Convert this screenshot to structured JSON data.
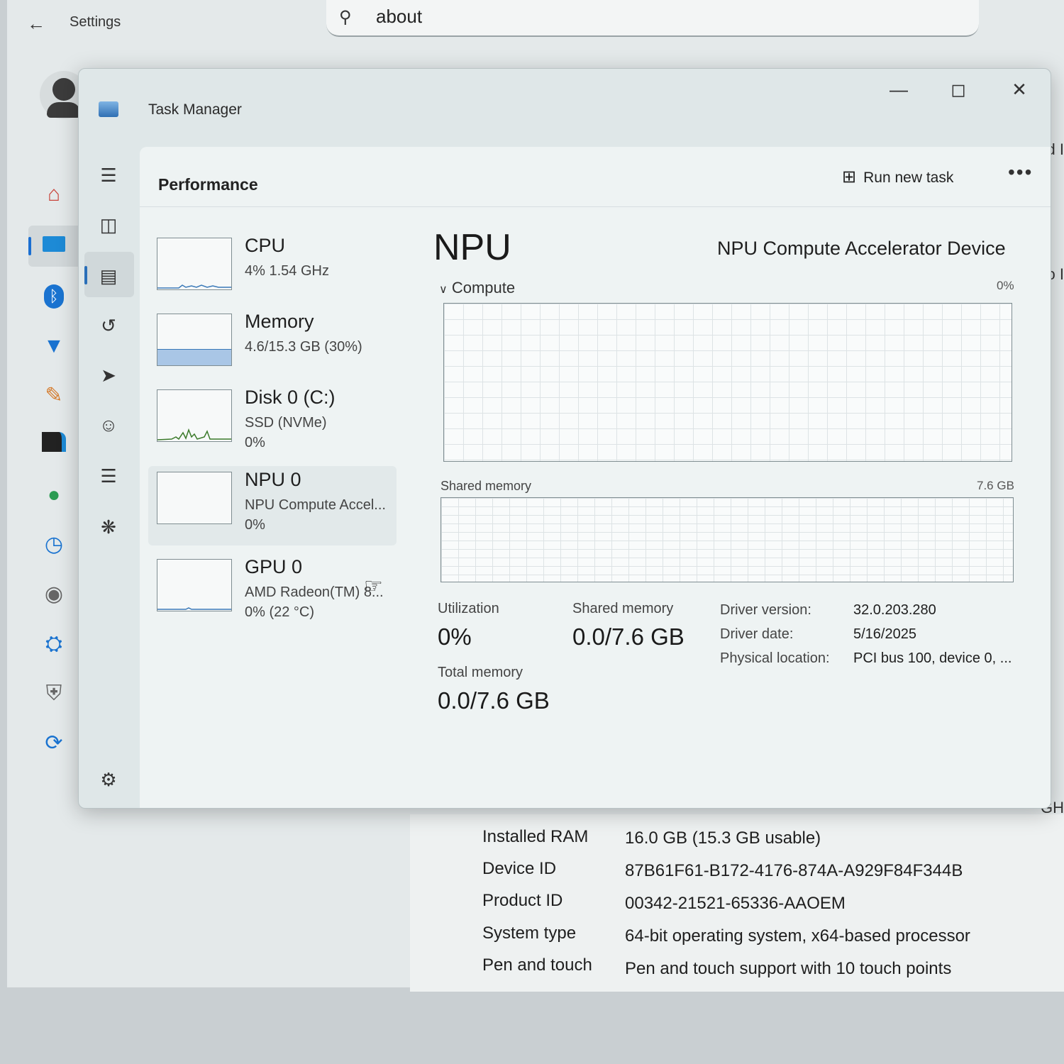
{
  "settings": {
    "title": "Settings",
    "search_value": "about",
    "nav_icons": [
      "home-icon",
      "system-icon",
      "bluetooth-icon",
      "wifi-icon",
      "personalization-icon",
      "apps-icon",
      "accounts-icon",
      "time-language-icon",
      "gaming-icon",
      "accessibility-icon",
      "privacy-security-icon",
      "windows-update-icon"
    ],
    "clipped_text": [
      "d I",
      "o I",
      "GH"
    ],
    "about_specs": [
      {
        "label": "Installed RAM",
        "value": "16.0 GB (15.3 GB usable)"
      },
      {
        "label": "Device ID",
        "value": "87B61F61-B172-4176-874A-A929F84F344B"
      },
      {
        "label": "Product ID",
        "value": "00342-21521-65336-AAOEM"
      },
      {
        "label": "System type",
        "value": "64-bit operating system, x64-based processor"
      },
      {
        "label": "Pen and touch",
        "value": "Pen and touch support with 10 touch points"
      }
    ]
  },
  "task_manager": {
    "title": "Task Manager",
    "page_title": "Performance",
    "run_new_task": "Run new task",
    "more": "•••",
    "rail_icons": [
      "hamburger-menu-icon",
      "processes-icon",
      "performance-icon",
      "app-history-icon",
      "startup-apps-icon",
      "users-icon",
      "details-icon",
      "services-icon",
      "settings-icon"
    ],
    "resources": [
      {
        "name": "CPU",
        "sub1": "4%  1.54 GHz",
        "sub2": ""
      },
      {
        "name": "Memory",
        "sub1": "4.6/15.3 GB (30%)",
        "sub2": "",
        "memory_fraction": 0.3
      },
      {
        "name": "Disk 0 (C:)",
        "sub1": "SSD (NVMe)",
        "sub2": "0%"
      },
      {
        "name": "NPU 0",
        "sub1": "NPU Compute Accel...",
        "sub2": "0%"
      },
      {
        "name": "GPU 0",
        "sub1": "AMD Radeon(TM) 8...",
        "sub2": "0%  (22 °C)"
      }
    ],
    "detail": {
      "heading": "NPU",
      "device_name": "NPU Compute Accelerator Device",
      "compute_label": "Compute",
      "compute_max": "0%",
      "shared_memory_label": "Shared memory",
      "shared_memory_max": "7.6 GB",
      "utilization_label": "Utilization",
      "utilization_value": "0%",
      "shared_mem_stat_label": "Shared memory",
      "shared_mem_stat_value": "0.0/7.6 GB",
      "total_memory_label": "Total memory",
      "total_memory_value": "0.0/7.6 GB",
      "driver": [
        {
          "label": "Driver version:",
          "value": "32.0.203.280"
        },
        {
          "label": "Driver date:",
          "value": "5/16/2025"
        },
        {
          "label": "Physical location:",
          "value": "PCI bus 100, device 0, ..."
        }
      ]
    }
  }
}
